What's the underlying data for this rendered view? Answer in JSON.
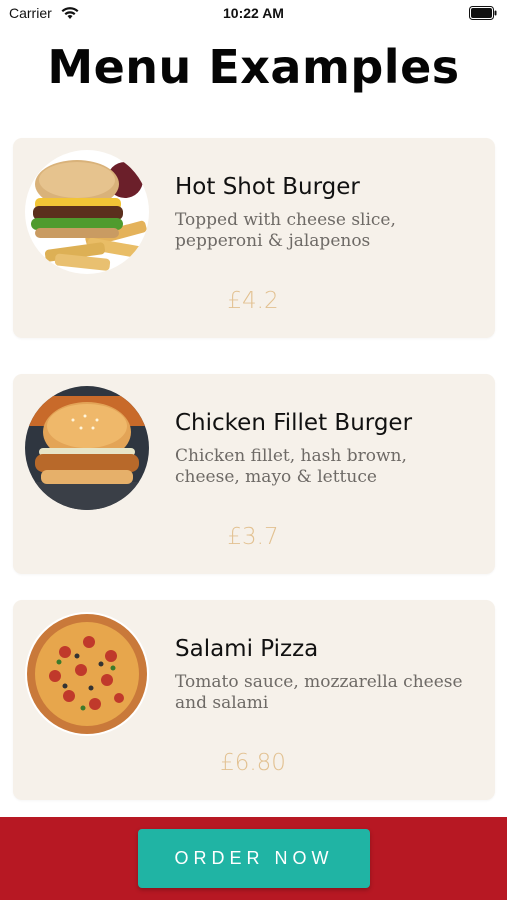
{
  "status_bar": {
    "carrier": "Carrier",
    "time": "10:22 AM",
    "icons": [
      "wifi-icon",
      "battery-icon"
    ]
  },
  "page": {
    "title": "Menu Examples"
  },
  "menu": {
    "items": [
      {
        "name": "Hot Shot Burger",
        "description": "Topped with cheese slice, pepperoni & jalapenos",
        "price": "£4.2",
        "image": "burger-with-fries-image"
      },
      {
        "name": "Chicken Fillet Burger",
        "description": "Chicken fillet, hash brown, cheese, mayo & lettuce",
        "price": "£3.7",
        "image": "chicken-burger-image"
      },
      {
        "name": "Salami Pizza",
        "description": "Tomato sauce, mozzarella cheese and salami",
        "price": "£6.80",
        "image": "salami-pizza-image"
      }
    ]
  },
  "footer": {
    "order_label": "ORDER NOW"
  },
  "colors": {
    "card_background": "#f6f1ea",
    "price": "#e2c191",
    "footer_background": "#b71823",
    "button_background": "#20b4a4"
  }
}
